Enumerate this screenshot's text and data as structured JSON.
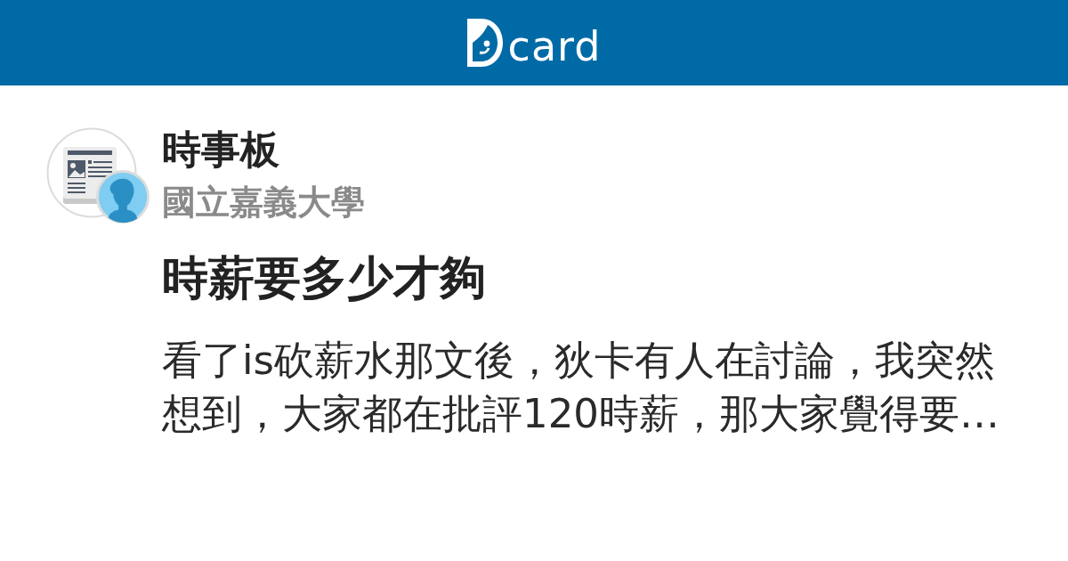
{
  "header": {
    "logo_text": "card"
  },
  "post": {
    "forum": "時事板",
    "school": "國立嘉義大學",
    "title": "時薪要多少才夠",
    "excerpt": "看了is砍薪水那文後，狄卡有人在討論，我突然想到，大家都在批評120時薪，那大家覺得要…"
  }
}
